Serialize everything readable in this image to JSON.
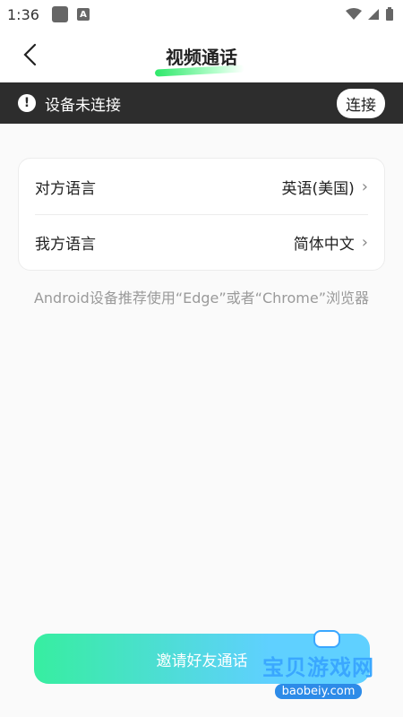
{
  "status_bar": {
    "time": "1:36"
  },
  "header": {
    "title": "视频通话"
  },
  "banner": {
    "text": "设备未连接",
    "button_label": "连接"
  },
  "settings": {
    "rows": [
      {
        "label": "对方语言",
        "value": "英语(美国)"
      },
      {
        "label": "我方语言",
        "value": "简体中文"
      }
    ]
  },
  "hint": "Android设备推荐使用“Edge”或者“Chrome”浏览器",
  "bottom_button": {
    "label": "邀请好友通话"
  },
  "watermark": {
    "title": "宝贝游戏网",
    "subtitle": "baobeiy.com"
  },
  "colors": {
    "banner_bg": "#2d2d2d",
    "accent_green": "#2ee86a",
    "button_gradient_start": "#37eea0",
    "button_gradient_end": "#5fd0ff"
  },
  "icons": {
    "back": "chevron-left-icon",
    "info": "info-icon",
    "chevron": "chevron-right-icon"
  }
}
